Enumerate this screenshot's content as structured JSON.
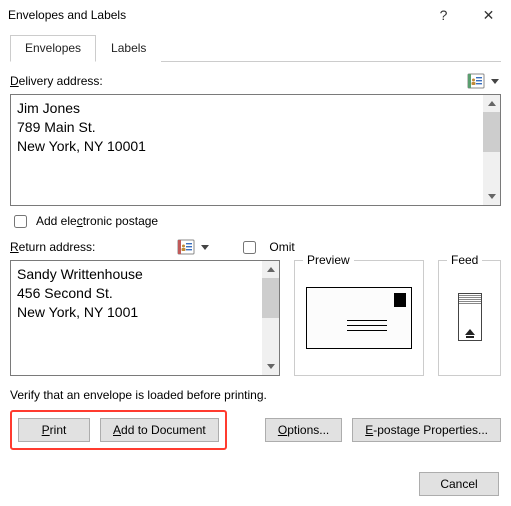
{
  "titlebar": {
    "title": "Envelopes and Labels",
    "help": "?",
    "close": "✕"
  },
  "tabs": {
    "envelopes": "Envelopes",
    "labels": "Labels"
  },
  "delivery": {
    "label_pre": "D",
    "label_rest": "elivery address:",
    "value": "Jim Jones\n789 Main St.\nNew York, NY 10001"
  },
  "electronic_postage": {
    "label_pre": "Add ele",
    "label_u": "c",
    "label_rest": "tronic postage"
  },
  "return": {
    "label_pre": "R",
    "label_rest": "eturn address:",
    "omit_pre": "O",
    "omit_rest": "mit",
    "value": "Sandy Writtenhouse\n456 Second St.\nNew York, NY 1001"
  },
  "panels": {
    "preview": "Preview",
    "feed": "Feed"
  },
  "verify": "Verify that an envelope is loaded before printing.",
  "buttons": {
    "print": "Print",
    "add_doc": "Add to Document",
    "options": "Options...",
    "epostage": "E-postage Properties...",
    "cancel": "Cancel"
  }
}
